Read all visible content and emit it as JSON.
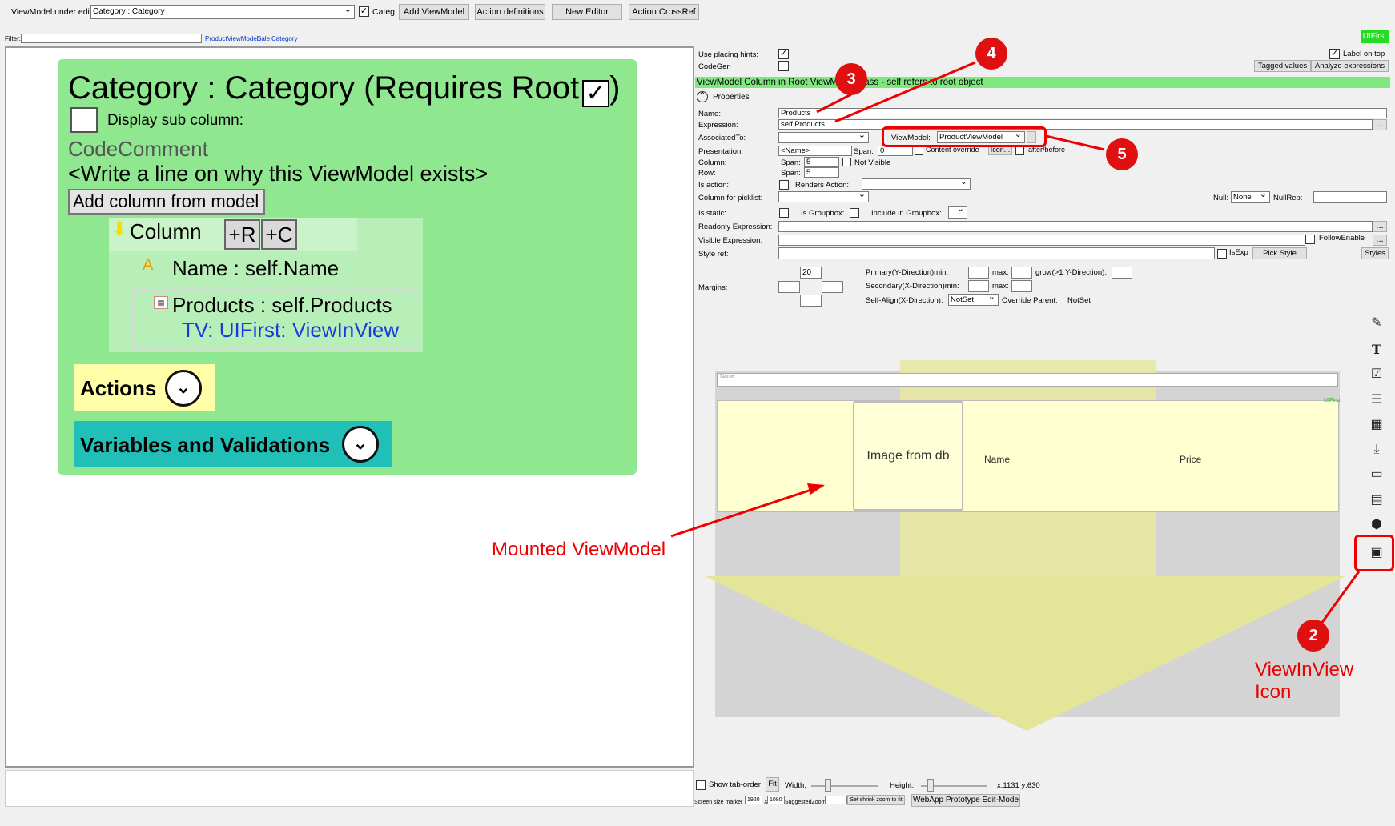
{
  "topbar": {
    "vm_label": "ViewModel under edit:",
    "vm_value": "Category : Category",
    "categ_label": "Categ",
    "add_vm": "Add ViewModel",
    "action_defs": "Action definitions",
    "new_editor": "New Editor",
    "action_xref": "Action CrossRef"
  },
  "filter": {
    "label": "Filter:",
    "link1": "ProductViewModel",
    "link2": "Sale",
    "link3": "Category"
  },
  "canvas": {
    "title": "Category : Category  (Requires Root",
    "display_sub": "Display sub column:",
    "code_comment": "CodeComment",
    "comment_text": "<Write a line on why this ViewModel exists>",
    "add_column": "Add column from model",
    "column": "Column",
    "plus_r": "+R",
    "plus_c": "+C",
    "name_row": "Name : self.Name",
    "products_row": "Products : self.Products",
    "tv_row": "TV: UIFirst: ViewInView",
    "actions": "Actions",
    "vars": "Variables and Validations"
  },
  "props": {
    "uifirst": "UIFirst",
    "use_hints": "Use placing hints:",
    "codegen": "CodeGen :",
    "label_top": "Label on top",
    "tagged": "Tagged values",
    "analyze": "Analyze expressions",
    "banner": "ViewModel Column in Root ViewModel class - self refers to root object",
    "properties": "Properties",
    "name_lbl": "Name:",
    "name_val": "Products",
    "expr_lbl": "Expression:",
    "expr_val": "self.Products",
    "assoc_lbl": "AssociatedTo:",
    "vm_lbl": "ViewModel:",
    "vm_val": "ProductViewModel",
    "pres_lbl": "Presentation:",
    "pres_val": "<Name>",
    "span_lbl": "Span:",
    "span0": "0",
    "content_override": "Content override",
    "icon_btn": "Icon...",
    "after_before": "after/before",
    "col_lbl": "Column:",
    "row_lbl": "Row:",
    "span5": "5",
    "not_visible": "Not Visible",
    "is_action": "Is action:",
    "renders_action": "Renders Action:",
    "picklist": "Column for picklist:",
    "null_lbl": "Null:",
    "null_val": "None",
    "nullrep": "NullRep:",
    "is_static": "Is static:",
    "is_groupbox": "Is Groupbox:",
    "include_gb": "Include in Groupbox:",
    "readonly": "Readonly Expression:",
    "visible": "Visible Expression:",
    "follow": "FollowEnable",
    "style_ref": "Style ref:",
    "isexp": "IsExp",
    "pick_style": "Pick Style",
    "styles": "Styles",
    "margin_top": "20",
    "margins": "Margins:",
    "primary": "Primary(Y-Direction)min:",
    "max": "max:",
    "grow": "grow(>1 Y-Direction):",
    "secondary": "Secondary(X-Direction)min:",
    "selfalign": "Self-Align(X-Direction):",
    "notset": "NotSet",
    "override": "Override Parent:",
    "override_val": "NotSet"
  },
  "preview": {
    "name_field": "Name",
    "uifirst_small": "UIFirst",
    "image": "Image from db",
    "name": "Name",
    "price": "Price"
  },
  "bottom": {
    "show_tab": "Show tab-order",
    "fit": "Fit",
    "width": "Width:",
    "height": "Height:",
    "coords": "x:1131 y:630",
    "screen_marker": "Screen size marker",
    "w1920": "1920",
    "x": "X",
    "h1080": "1080",
    "suggested": "SuggestedZoom",
    "shrink": "Set shrink zoom to fit",
    "webapp": "WebApp Prototype Edit-Mode"
  },
  "annotations": {
    "c2": "2",
    "c3": "3",
    "c4": "4",
    "c5": "5",
    "mounted": "Mounted ViewModel",
    "viv1": "ViewInView",
    "viv2": "Icon"
  }
}
